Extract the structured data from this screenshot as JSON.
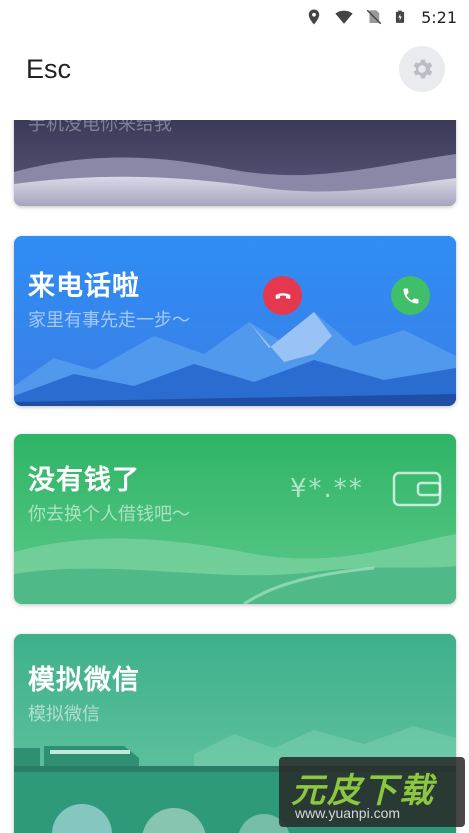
{
  "status_bar": {
    "time": "5:21",
    "icons": [
      "location-icon",
      "wifi-icon",
      "no-sim-icon",
      "battery-charging-icon"
    ]
  },
  "app_bar": {
    "title": "Esc",
    "settings_icon": "gear-icon"
  },
  "cards": {
    "dusk": {
      "subtitle": "手机没电你来给我"
    },
    "call": {
      "title": "来电话啦",
      "subtitle": "家里有事先走一步～",
      "hangup_icon": "phone-hangup-icon",
      "answer_icon": "phone-answer-icon"
    },
    "money": {
      "title": "没有钱了",
      "subtitle": "你去换个人借钱吧～",
      "amount": "¥*.**",
      "wallet_icon": "wallet-icon"
    },
    "wechat": {
      "title": "模拟微信",
      "subtitle": "模拟微信"
    }
  },
  "watermark": {
    "text": "元皮下载",
    "url": "www.yuanpi.com"
  },
  "colors": {
    "call_blue": "#2f86f3",
    "money_green": "#34b86b",
    "wechat_teal": "#43b38f",
    "hangup_red": "#e5384f",
    "answer_green": "#3fbf6a"
  }
}
